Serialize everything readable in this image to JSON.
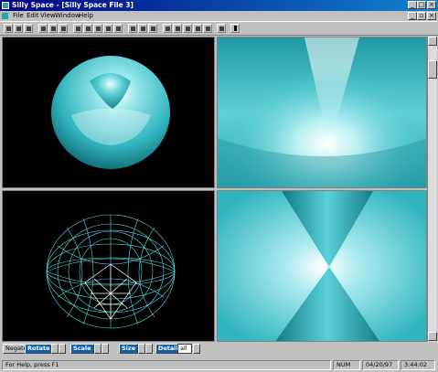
{
  "window": {
    "title": "Silly Space - [Silly Space File 3]"
  },
  "menu": [
    "File",
    "Edit",
    "View",
    "Window",
    "Help"
  ],
  "toolbar": {
    "icons": [
      "new-file-icon",
      "open-file-icon",
      "save-icon",
      "cut-icon",
      "copy-icon",
      "paste-icon",
      "select-arrow-icon",
      "select-icon",
      "rotate-icon",
      "pan-icon",
      "zoom-icon",
      "light-icon",
      "move-icon",
      "move-alt-icon",
      "box-icon",
      "grid-icon",
      "wire-icon",
      "solid-icon",
      "shade-icon",
      "render-icon",
      "help-icon"
    ]
  },
  "controls": {
    "negate_label": "Negate",
    "rotate_label": "Rotate",
    "scale_label": "Scale",
    "size_label": "Size",
    "detail_label": "Detail",
    "detail_value": "all"
  },
  "status": {
    "help_text": "For Help, press F1",
    "num": "NUM",
    "date": "04/20/97",
    "time": "3:44:02"
  },
  "colors": {
    "surface": "#3fbcc4",
    "highlight": "#ffffff",
    "wire": "#50e0e8",
    "background": "#000000"
  }
}
